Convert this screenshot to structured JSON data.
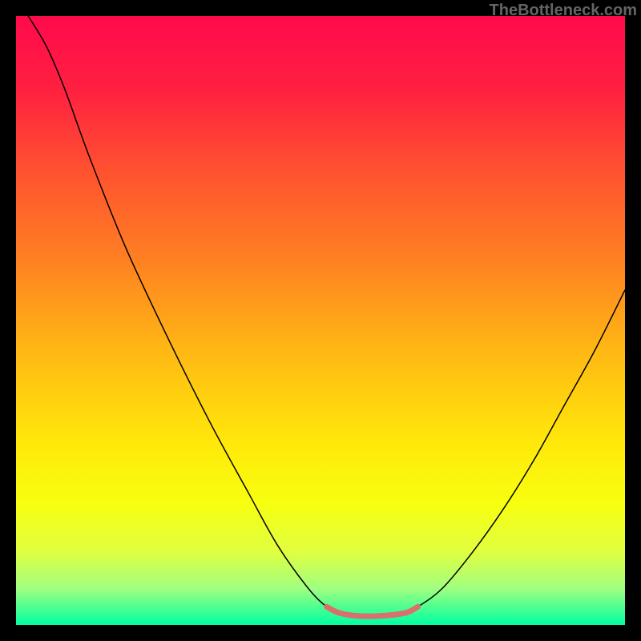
{
  "watermark": "TheBottleneck.com",
  "chart_data": {
    "type": "line",
    "title": "",
    "xlabel": "",
    "ylabel": "",
    "xlim": [
      0,
      100
    ],
    "ylim": [
      0,
      100
    ],
    "gradient_stops": [
      {
        "offset": 0,
        "color": "#ff0a4c"
      },
      {
        "offset": 12,
        "color": "#ff2040"
      },
      {
        "offset": 25,
        "color": "#ff5030"
      },
      {
        "offset": 40,
        "color": "#ff8022"
      },
      {
        "offset": 55,
        "color": "#ffb814"
      },
      {
        "offset": 70,
        "color": "#ffe80a"
      },
      {
        "offset": 80,
        "color": "#f8ff10"
      },
      {
        "offset": 88,
        "color": "#e0ff40"
      },
      {
        "offset": 94,
        "color": "#a0ff80"
      },
      {
        "offset": 100,
        "color": "#00ffa0"
      }
    ],
    "series": [
      {
        "name": "bottleneck-curve",
        "color": "#000000",
        "stroke_width": 1.5,
        "points": [
          {
            "x": 2,
            "y": 100
          },
          {
            "x": 5,
            "y": 95
          },
          {
            "x": 8,
            "y": 88
          },
          {
            "x": 12,
            "y": 77
          },
          {
            "x": 18,
            "y": 62
          },
          {
            "x": 25,
            "y": 47
          },
          {
            "x": 32,
            "y": 33
          },
          {
            "x": 38,
            "y": 22
          },
          {
            "x": 43,
            "y": 13
          },
          {
            "x": 48,
            "y": 6
          },
          {
            "x": 51,
            "y": 3
          },
          {
            "x": 53,
            "y": 2
          },
          {
            "x": 56,
            "y": 1.5
          },
          {
            "x": 60,
            "y": 1.5
          },
          {
            "x": 64,
            "y": 2
          },
          {
            "x": 66,
            "y": 3
          },
          {
            "x": 70,
            "y": 6
          },
          {
            "x": 75,
            "y": 12
          },
          {
            "x": 80,
            "y": 19
          },
          {
            "x": 85,
            "y": 27
          },
          {
            "x": 90,
            "y": 36
          },
          {
            "x": 95,
            "y": 45
          },
          {
            "x": 100,
            "y": 55
          }
        ]
      },
      {
        "name": "optimal-zone-highlight",
        "color": "#d97070",
        "stroke_width": 7,
        "points": [
          {
            "x": 51,
            "y": 3
          },
          {
            "x": 53,
            "y": 2
          },
          {
            "x": 56,
            "y": 1.5
          },
          {
            "x": 60,
            "y": 1.5
          },
          {
            "x": 64,
            "y": 2
          },
          {
            "x": 66,
            "y": 3
          }
        ]
      }
    ]
  }
}
